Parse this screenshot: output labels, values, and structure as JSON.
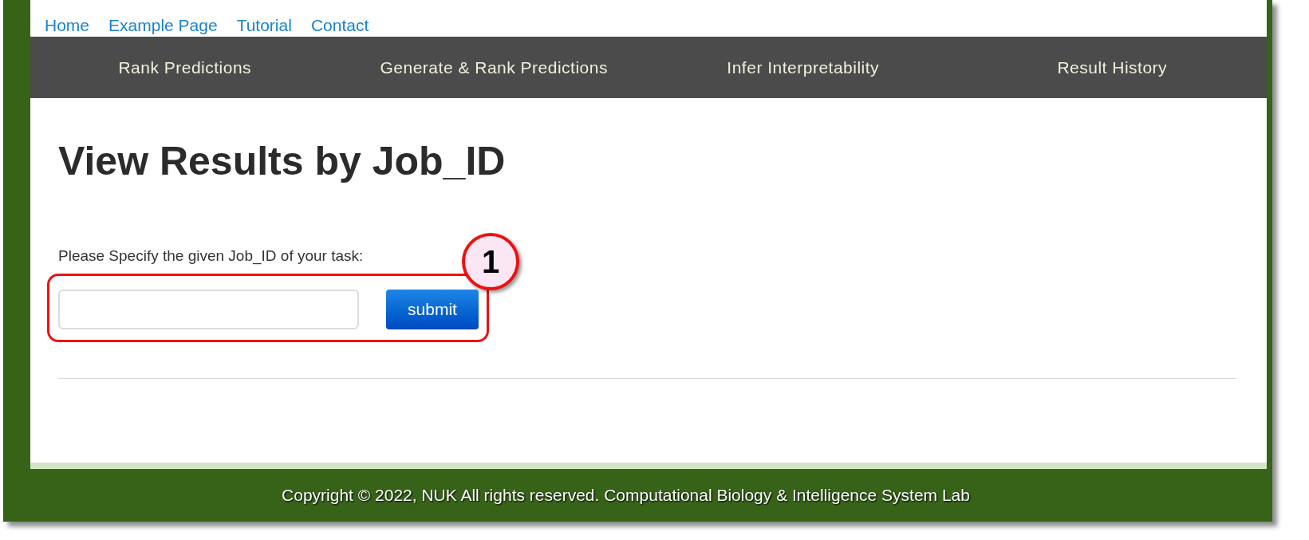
{
  "top_links": [
    "Home",
    "Example Page",
    "Tutorial",
    "Contact"
  ],
  "nav": [
    "Rank Predictions",
    "Generate & Rank Predictions",
    "Infer Interpretability",
    "Result History"
  ],
  "heading": "View Results by Job_ID",
  "form": {
    "label": "Please Specify the given Job_ID of your task:",
    "button": "submit"
  },
  "annotation": {
    "number": "1"
  },
  "footer": "Copyright © 2022, NUK All rights reserved. Computational Biology & Intelligence System Lab"
}
